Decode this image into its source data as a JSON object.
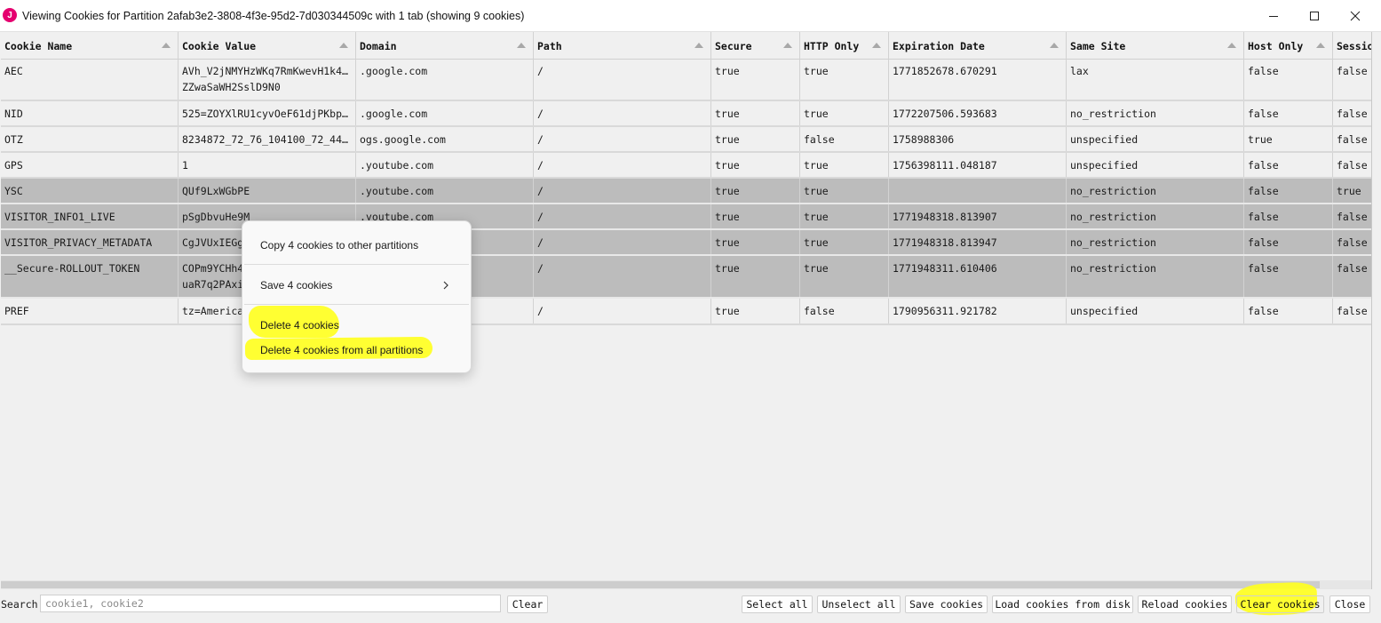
{
  "window": {
    "icon_letter": "J",
    "title": "Viewing Cookies for Partition 2afab3e2-3808-4f3e-95d2-7d030344509c with 1 tab (showing 9 cookies)"
  },
  "table": {
    "columns": [
      "Cookie Name",
      "Cookie Value",
      "Domain",
      "Path",
      "Secure",
      "HTTP Only",
      "Expiration Date",
      "Same Site",
      "Host Only",
      "Sessio"
    ],
    "rows": [
      {
        "selected": false,
        "cells": [
          "AEC",
          [
            "AVh_V2jNMYHzWKq7RmKwevH1k4y…",
            "ZZwaSaWH2SslD9N0"
          ],
          ".google.com",
          "/",
          "true",
          "true",
          "1771852678.670291",
          "lax",
          "false",
          "false"
        ]
      },
      {
        "selected": false,
        "cells": [
          "NID",
          [
            "525=ZOYXlRU1cyvOeF61djPKbpR…"
          ],
          ".google.com",
          "/",
          "true",
          "true",
          "1772207506.593683",
          "no_restriction",
          "false",
          "false"
        ]
      },
      {
        "selected": false,
        "cells": [
          "OTZ",
          [
            "8234872_72_76_104100_72_446…"
          ],
          "ogs.google.com",
          "/",
          "true",
          "false",
          "1758988306",
          "unspecified",
          "true",
          "false"
        ]
      },
      {
        "selected": false,
        "cells": [
          "GPS",
          [
            "1"
          ],
          ".youtube.com",
          "/",
          "true",
          "true",
          "1756398111.048187",
          "unspecified",
          "false",
          "false"
        ]
      },
      {
        "selected": true,
        "cells": [
          "YSC",
          [
            "QUf9LxWGbPE"
          ],
          ".youtube.com",
          "/",
          "true",
          "true",
          "",
          "no_restriction",
          "false",
          "true"
        ]
      },
      {
        "selected": true,
        "cells": [
          "VISITOR_INFO1_LIVE",
          [
            "pSgDbvuHe9M"
          ],
          ".youtube.com",
          "/",
          "true",
          "true",
          "1771948318.813907",
          "no_restriction",
          "false",
          "false"
        ]
      },
      {
        "selected": true,
        "cells": [
          "VISITOR_PRIVACY_METADATA",
          [
            "CgJVUxIEGg"
          ],
          "",
          "/",
          "true",
          "true",
          "1771948318.813947",
          "no_restriction",
          "false",
          "false"
        ]
      },
      {
        "selected": true,
        "cells": [
          "__Secure-ROLLOUT_TOKEN",
          [
            "COPm9YCHh4",
            "uaR7q2PAxi"
          ],
          "",
          "/",
          "true",
          "true",
          "1771948311.610406",
          "no_restriction",
          "false",
          "false"
        ]
      },
      {
        "selected": false,
        "cells": [
          "PREF",
          [
            "tz=America"
          ],
          "",
          "/",
          "true",
          "false",
          "1790956311.921782",
          "unspecified",
          "false",
          "false"
        ]
      }
    ]
  },
  "context_menu": {
    "copy_label": "Copy 4 cookies to other partitions",
    "save_label": "Save 4 cookies",
    "delete_label": "Delete 4 cookies",
    "delete_all_label": "Delete 4 cookies from all partitions"
  },
  "bottom": {
    "search_label": "Search",
    "search_placeholder": "cookie1, cookie2",
    "clear_label": "Clear",
    "select_all": "Select all",
    "unselect_all": "Unselect all",
    "save_cookies": "Save cookies",
    "load_cookies": "Load cookies from disk",
    "reload_cookies": "Reload cookies",
    "clear_cookies": "Clear cookies",
    "close": "Close"
  },
  "colors": {
    "selection": "#bcbcbc",
    "highlight": "#ffff21",
    "app_icon": "#e5006f"
  }
}
